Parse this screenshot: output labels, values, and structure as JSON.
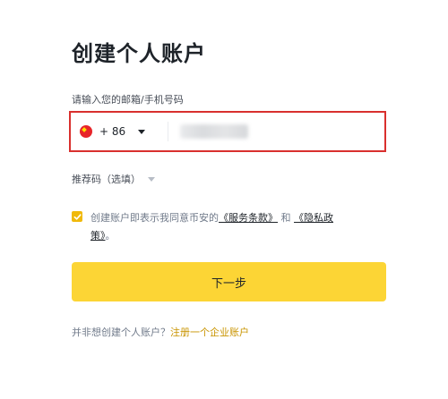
{
  "page": {
    "title": "创建个人账户"
  },
  "phone_field": {
    "label": "请输入您的邮箱/手机号码",
    "country_flag": "china-flag-icon",
    "dial_code": "+ 86",
    "value": "",
    "highlight_color": "#d9302e"
  },
  "referral": {
    "label": "推荐码（选填）"
  },
  "agreement": {
    "checked": true,
    "prefix": "创建账户即表示我同意币安的",
    "terms_link": "《服务条款》",
    "and": "和",
    "privacy_link_line1": "《隐私政",
    "privacy_link_line2": "策》",
    "suffix": "。"
  },
  "actions": {
    "next_label": "下一步"
  },
  "footer": {
    "question": "并非想创建个人账户？",
    "link": "注册一个企业账户"
  },
  "colors": {
    "accent": "#fcd535",
    "checkbox": "#f0b90b",
    "link": "#c99400"
  }
}
